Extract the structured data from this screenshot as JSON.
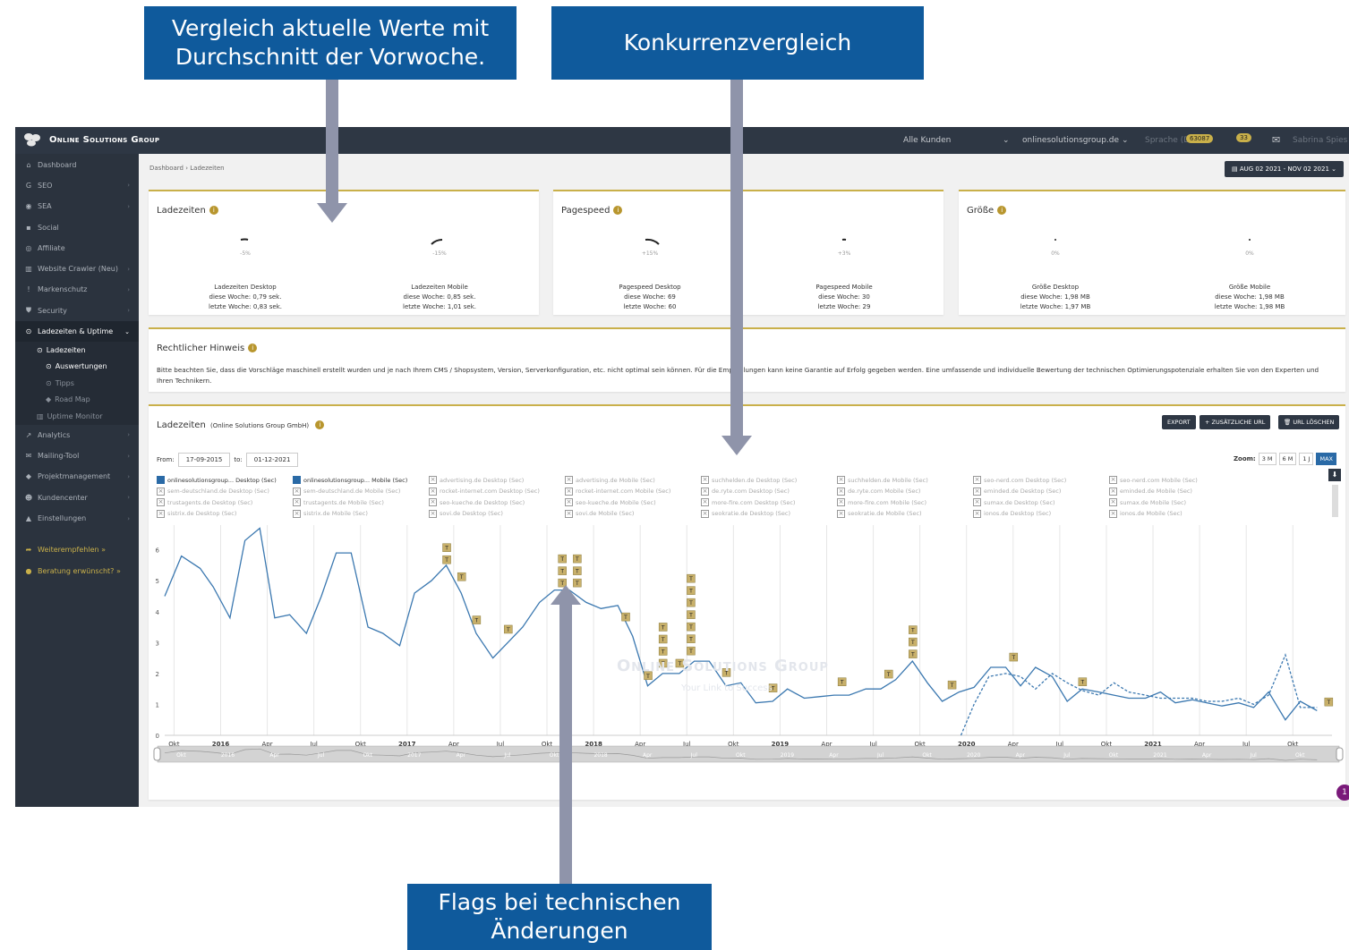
{
  "callouts": {
    "vergleich_line1": "Vergleich aktuelle Werte mit",
    "vergleich_line2": "Durchschnitt der Vorwoche.",
    "konkurrenz": "Konkurrenzvergleich",
    "flags_line1": "Flags bei technischen",
    "flags_line2": "Änderungen"
  },
  "topbar": {
    "brand": "Online Solutions Group",
    "customers": "Alle Kunden",
    "domain": "onlinesolutionsgroup.de",
    "language": "Sprache (DE)",
    "badge1": "63087",
    "badge2": "33",
    "user": "Sabrina Spies"
  },
  "sidebar": {
    "items": [
      {
        "icon": "⌂",
        "label": "Dashboard"
      },
      {
        "icon": "G",
        "label": "SEO"
      },
      {
        "icon": "◉",
        "label": "SEA"
      },
      {
        "icon": "▪",
        "label": "Social"
      },
      {
        "icon": "◎",
        "label": "Affiliate"
      },
      {
        "icon": "▥",
        "label": "Website Crawler (Neu)"
      },
      {
        "icon": "!",
        "label": "Markenschutz"
      },
      {
        "icon": "⛊",
        "label": "Security"
      },
      {
        "icon": "⊙",
        "label": "Ladezeiten & Uptime"
      }
    ],
    "sub": [
      {
        "label": "Ladezeiten"
      },
      {
        "label": "Auswertungen"
      },
      {
        "label": "Tipps"
      },
      {
        "label": "Road Map"
      },
      {
        "label": "Uptime Monitor"
      }
    ],
    "items2": [
      {
        "icon": "↗",
        "label": "Analytics"
      },
      {
        "icon": "✉",
        "label": "Mailing-Tool"
      },
      {
        "icon": "◆",
        "label": "Projektmanagement"
      },
      {
        "icon": "☻",
        "label": "Kundencenter"
      },
      {
        "icon": "▲",
        "label": "Einstellungen"
      }
    ],
    "links": [
      {
        "label": "Weiterempfehlen »"
      },
      {
        "label": "Beratung erwünscht? »"
      }
    ]
  },
  "breadcrumb": {
    "home": "Dashboard",
    "sep": "›",
    "current": "Ladezeiten"
  },
  "daterange": "▤ AUG 02 2021 - NOV 02 2021 ⌄",
  "cards": [
    {
      "title": "Ladezeiten",
      "metrics": [
        {
          "pct": "-5%",
          "label": "Ladezeiten Desktop",
          "line1": "diese Woche: 0,79 sek.",
          "line2": "letzte Woche: 0,83 sek."
        },
        {
          "pct": "-15%",
          "label": "Ladezeiten Mobile",
          "line1": "diese Woche: 0,85 sek.",
          "line2": "letzte Woche: 1,01 sek."
        }
      ]
    },
    {
      "title": "Pagespeed",
      "metrics": [
        {
          "pct": "+15%",
          "label": "Pagespeed Desktop",
          "line1": "diese Woche: 69",
          "line2": "letzte Woche: 60"
        },
        {
          "pct": "+3%",
          "label": "Pagespeed Mobile",
          "line1": "diese Woche: 30",
          "line2": "letzte Woche: 29"
        }
      ]
    },
    {
      "title": "Größe",
      "metrics": [
        {
          "pct": "0%",
          "label": "Größe Desktop",
          "line1": "diese Woche: 1,98 MB",
          "line2": "letzte Woche: 1,97 MB"
        },
        {
          "pct": "0%",
          "label": "Größe Mobile",
          "line1": "diese Woche: 1,98 MB",
          "line2": "letzte Woche: 1,98 MB"
        }
      ]
    }
  ],
  "legal": {
    "title": "Rechtlicher Hinweis",
    "text": "Bitte beachten Sie, dass die Vorschläge maschinell erstellt wurden und je nach Ihrem CMS / Shopsystem, Version, Serverkonfiguration, etc. nicht optimal sein können. Für die Empfehlungen kann keine Garantie auf Erfolg gegeben werden. Eine umfassende und individuelle Bewertung der technischen Optimierungspotenziale erhalten Sie von den Experten und Ihren Technikern."
  },
  "chart_panel": {
    "title": "Ladezeiten",
    "subtitle": "(Online Solutions Group GmbH)",
    "export": "EXPORT",
    "add_url": "+ ZUSÄTZLICHE URL",
    "delete_url": "🗑 URL LÖSCHEN",
    "from_label": "From:",
    "from_value": "17-09-2015",
    "to_label": "to:",
    "to_value": "01-12-2021",
    "zoom_label": "Zoom:",
    "zoom_options": [
      "3 M",
      "6 M",
      "1 J",
      "MAX"
    ],
    "watermark1": "Online Solutions Group",
    "watermark2": "Your Link to Success",
    "notification": "1"
  },
  "legend": [
    {
      "name": "onlinesolutionsgroup... Desktop (Sec)",
      "on": true,
      "color": "#2a6aa6"
    },
    {
      "name": "onlinesolutionsgroup... Mobile (Sec)",
      "on": true,
      "color": "#2a6aa6"
    },
    {
      "name": "advertising.de Desktop (Sec)",
      "on": false
    },
    {
      "name": "advertising.de Mobile (Sec)",
      "on": false
    },
    {
      "name": "suchhelden.de Desktop (Sec)",
      "on": false
    },
    {
      "name": "suchhelden.de Mobile (Sec)",
      "on": false
    },
    {
      "name": "seo-nerd.com Desktop (Sec)",
      "on": false
    },
    {
      "name": "seo-nerd.com Mobile (Sec)",
      "on": false
    },
    {
      "name": "sem-deutschland.de Desktop (Sec)",
      "on": false
    },
    {
      "name": "sem-deutschland.de Mobile (Sec)",
      "on": false
    },
    {
      "name": "rocket-internet.com Desktop (Sec)",
      "on": false
    },
    {
      "name": "rocket-internet.com Mobile (Sec)",
      "on": false
    },
    {
      "name": "de.ryte.com Desktop (Sec)",
      "on": false
    },
    {
      "name": "de.ryte.com Mobile (Sec)",
      "on": false
    },
    {
      "name": "eminded.de Desktop (Sec)",
      "on": false
    },
    {
      "name": "eminded.de Mobile (Sec)",
      "on": false
    },
    {
      "name": "trustagents.de Desktop (Sec)",
      "on": false
    },
    {
      "name": "trustagents.de Mobile (Sec)",
      "on": false
    },
    {
      "name": "seo-kueche.de Desktop (Sec)",
      "on": false
    },
    {
      "name": "seo-kueche.de Mobile (Sec)",
      "on": false
    },
    {
      "name": "more-fire.com Desktop (Sec)",
      "on": false
    },
    {
      "name": "more-fire.com Mobile (Sec)",
      "on": false
    },
    {
      "name": "sumax.de Desktop (Sec)",
      "on": false
    },
    {
      "name": "sumax.de Mobile (Sec)",
      "on": false
    },
    {
      "name": "sistrix.de Desktop (Sec)",
      "on": false
    },
    {
      "name": "sistrix.de Mobile (Sec)",
      "on": false
    },
    {
      "name": "sovi.de Desktop (Sec)",
      "on": false
    },
    {
      "name": "sovi.de Mobile (Sec)",
      "on": false
    },
    {
      "name": "seokratie.de Desktop (Sec)",
      "on": false
    },
    {
      "name": "seokratie.de Mobile (Sec)",
      "on": false
    },
    {
      "name": "ionos.de Desktop (Sec)",
      "on": false
    },
    {
      "name": "ionos.de Mobile (Sec)",
      "on": false
    }
  ],
  "chart_data": {
    "type": "line",
    "ylim": [
      0,
      6.8
    ],
    "yticks": [
      0,
      1,
      2,
      3,
      4,
      5,
      6
    ],
    "xlim": [
      2015.7,
      2021.96
    ],
    "xticks": [
      {
        "t": 2015.75,
        "label": "Okt",
        "bold": false
      },
      {
        "t": 2016.0,
        "label": "2016",
        "bold": true
      },
      {
        "t": 2016.25,
        "label": "Apr",
        "bold": false
      },
      {
        "t": 2016.5,
        "label": "Jul",
        "bold": false
      },
      {
        "t": 2016.75,
        "label": "Okt",
        "bold": false
      },
      {
        "t": 2017.0,
        "label": "2017",
        "bold": true
      },
      {
        "t": 2017.25,
        "label": "Apr",
        "bold": false
      },
      {
        "t": 2017.5,
        "label": "Jul",
        "bold": false
      },
      {
        "t": 2017.75,
        "label": "Okt",
        "bold": false
      },
      {
        "t": 2018.0,
        "label": "2018",
        "bold": true
      },
      {
        "t": 2018.25,
        "label": "Apr",
        "bold": false
      },
      {
        "t": 2018.5,
        "label": "Jul",
        "bold": false
      },
      {
        "t": 2018.75,
        "label": "Okt",
        "bold": false
      },
      {
        "t": 2019.0,
        "label": "2019",
        "bold": true
      },
      {
        "t": 2019.25,
        "label": "Apr",
        "bold": false
      },
      {
        "t": 2019.5,
        "label": "Jul",
        "bold": false
      },
      {
        "t": 2019.75,
        "label": "Okt",
        "bold": false
      },
      {
        "t": 2020.0,
        "label": "2020",
        "bold": true
      },
      {
        "t": 2020.25,
        "label": "Apr",
        "bold": false
      },
      {
        "t": 2020.5,
        "label": "Jul",
        "bold": false
      },
      {
        "t": 2020.75,
        "label": "Okt",
        "bold": false
      },
      {
        "t": 2021.0,
        "label": "2021",
        "bold": true
      },
      {
        "t": 2021.25,
        "label": "Apr",
        "bold": false
      },
      {
        "t": 2021.5,
        "label": "Jul",
        "bold": false
      },
      {
        "t": 2021.75,
        "label": "Okt",
        "bold": false
      }
    ],
    "navigator_ticks": [
      "Okt",
      "2016",
      "Apr",
      "Jul",
      "Okt",
      "2017",
      "Apr",
      "Jul",
      "Okt",
      "2018",
      "Apr",
      "Jul",
      "Okt",
      "2019",
      "Apr",
      "Jul",
      "Okt",
      "2020",
      "Apr",
      "Jul",
      "Okt",
      "2021",
      "Apr",
      "Jul",
      "Okt"
    ],
    "series": [
      {
        "name": "onlinesolutionsgroup... Desktop (Sec)",
        "style": "solid",
        "color": "#3b78b0",
        "points": [
          [
            2015.7,
            4.5
          ],
          [
            2015.79,
            5.8
          ],
          [
            2015.89,
            5.4
          ],
          [
            2015.96,
            4.8
          ],
          [
            2016.05,
            3.8
          ],
          [
            2016.13,
            6.3
          ],
          [
            2016.21,
            6.7
          ],
          [
            2016.29,
            3.8
          ],
          [
            2016.37,
            3.9
          ],
          [
            2016.46,
            3.3
          ],
          [
            2016.54,
            4.5
          ],
          [
            2016.62,
            5.9
          ],
          [
            2016.7,
            5.9
          ],
          [
            2016.79,
            3.5
          ],
          [
            2016.87,
            3.3
          ],
          [
            2016.96,
            2.9
          ],
          [
            2017.04,
            4.6
          ],
          [
            2017.13,
            5.0
          ],
          [
            2017.21,
            5.5
          ],
          [
            2017.29,
            4.6
          ],
          [
            2017.37,
            3.3
          ],
          [
            2017.46,
            2.5
          ],
          [
            2017.54,
            3.0
          ],
          [
            2017.62,
            3.5
          ],
          [
            2017.71,
            4.3
          ],
          [
            2017.79,
            4.7
          ],
          [
            2017.87,
            4.7
          ],
          [
            2017.96,
            4.3
          ],
          [
            2018.04,
            4.1
          ],
          [
            2018.13,
            4.2
          ],
          [
            2018.21,
            3.2
          ],
          [
            2018.29,
            1.6
          ],
          [
            2018.37,
            2.0
          ],
          [
            2018.46,
            2.0
          ],
          [
            2018.54,
            2.4
          ],
          [
            2018.62,
            2.4
          ],
          [
            2018.71,
            1.6
          ],
          [
            2018.79,
            1.7
          ],
          [
            2018.87,
            1.05
          ],
          [
            2018.96,
            1.1
          ],
          [
            2019.04,
            1.5
          ],
          [
            2019.13,
            1.2
          ],
          [
            2019.21,
            1.25
          ],
          [
            2019.29,
            1.3
          ],
          [
            2019.37,
            1.3
          ],
          [
            2019.46,
            1.5
          ],
          [
            2019.54,
            1.5
          ],
          [
            2019.62,
            1.8
          ],
          [
            2019.71,
            2.4
          ],
          [
            2019.79,
            1.7
          ],
          [
            2019.87,
            1.1
          ],
          [
            2019.96,
            1.4
          ],
          [
            2020.04,
            1.55
          ],
          [
            2020.13,
            2.2
          ],
          [
            2020.21,
            2.2
          ],
          [
            2020.29,
            1.6
          ],
          [
            2020.37,
            2.2
          ],
          [
            2020.46,
            1.9
          ],
          [
            2020.54,
            1.1
          ],
          [
            2020.62,
            1.5
          ],
          [
            2020.71,
            1.4
          ],
          [
            2020.79,
            1.3
          ],
          [
            2020.87,
            1.2
          ],
          [
            2020.96,
            1.2
          ],
          [
            2021.04,
            1.4
          ],
          [
            2021.12,
            1.05
          ],
          [
            2021.21,
            1.15
          ],
          [
            2021.29,
            1.05
          ],
          [
            2021.37,
            0.95
          ],
          [
            2021.46,
            1.05
          ],
          [
            2021.54,
            0.9
          ],
          [
            2021.62,
            1.4
          ],
          [
            2021.71,
            0.5
          ],
          [
            2021.79,
            1.1
          ],
          [
            2021.88,
            0.8
          ]
        ]
      },
      {
        "name": "onlinesolutionsgroup... Mobile (Sec)",
        "style": "dashed",
        "color": "#3b78b0",
        "points": [
          [
            2019.97,
            0.0
          ],
          [
            2020.04,
            1.0
          ],
          [
            2020.12,
            1.9
          ],
          [
            2020.21,
            2.0
          ],
          [
            2020.29,
            1.9
          ],
          [
            2020.37,
            1.5
          ],
          [
            2020.46,
            2.0
          ],
          [
            2020.54,
            1.7
          ],
          [
            2020.62,
            1.45
          ],
          [
            2020.71,
            1.3
          ],
          [
            2020.79,
            1.7
          ],
          [
            2020.87,
            1.4
          ],
          [
            2020.96,
            1.3
          ],
          [
            2021.04,
            1.2
          ],
          [
            2021.12,
            1.2
          ],
          [
            2021.21,
            1.2
          ],
          [
            2021.29,
            1.1
          ],
          [
            2021.37,
            1.1
          ],
          [
            2021.46,
            1.2
          ],
          [
            2021.54,
            1.0
          ],
          [
            2021.62,
            1.3
          ],
          [
            2021.71,
            2.6
          ],
          [
            2021.79,
            0.9
          ],
          [
            2021.88,
            0.9
          ]
        ]
      }
    ],
    "flags": [
      {
        "t": 2017.21,
        "y": 5.55,
        "count": 2,
        "label": "T"
      },
      {
        "t": 2017.29,
        "y": 5.0,
        "count": 1,
        "label": "T"
      },
      {
        "t": 2017.37,
        "y": 3.6,
        "count": 1,
        "label": "T"
      },
      {
        "t": 2017.54,
        "y": 3.3,
        "count": 1,
        "label": "T"
      },
      {
        "t": 2017.83,
        "y": 4.8,
        "count": 3,
        "label": "T"
      },
      {
        "t": 2017.91,
        "y": 4.8,
        "count": 3,
        "label": "T"
      },
      {
        "t": 2018.17,
        "y": 3.7,
        "count": 1,
        "label": "T"
      },
      {
        "t": 2018.29,
        "y": 1.8,
        "count": 1,
        "label": "T"
      },
      {
        "t": 2018.37,
        "y": 2.2,
        "count": 4,
        "label": "T"
      },
      {
        "t": 2018.46,
        "y": 2.2,
        "count": 1,
        "label": "T"
      },
      {
        "t": 2018.52,
        "y": 2.6,
        "count": 7,
        "label": "T"
      },
      {
        "t": 2018.71,
        "y": 1.9,
        "count": 1,
        "label": "T"
      },
      {
        "t": 2018.96,
        "y": 1.4,
        "count": 1,
        "label": "T"
      },
      {
        "t": 2019.33,
        "y": 1.6,
        "count": 1,
        "label": "T"
      },
      {
        "t": 2019.58,
        "y": 1.85,
        "count": 1,
        "label": "T"
      },
      {
        "t": 2019.71,
        "y": 2.5,
        "count": 3,
        "label": "T"
      },
      {
        "t": 2019.92,
        "y": 1.5,
        "count": 1,
        "label": "T"
      },
      {
        "t": 2020.25,
        "y": 2.4,
        "count": 1,
        "label": "T"
      },
      {
        "t": 2020.62,
        "y": 1.6,
        "count": 1,
        "label": "T"
      },
      {
        "t": 2021.94,
        "y": 0.95,
        "count": 1,
        "label": "T"
      }
    ]
  },
  "colors": {
    "brand_blue": "#0f5a9c",
    "arrow": "#8f94aa",
    "dark_nav": "#2e3744",
    "accent_gold": "#c9b04a",
    "series": "#3b78b0",
    "flag": "#c8b06a"
  }
}
